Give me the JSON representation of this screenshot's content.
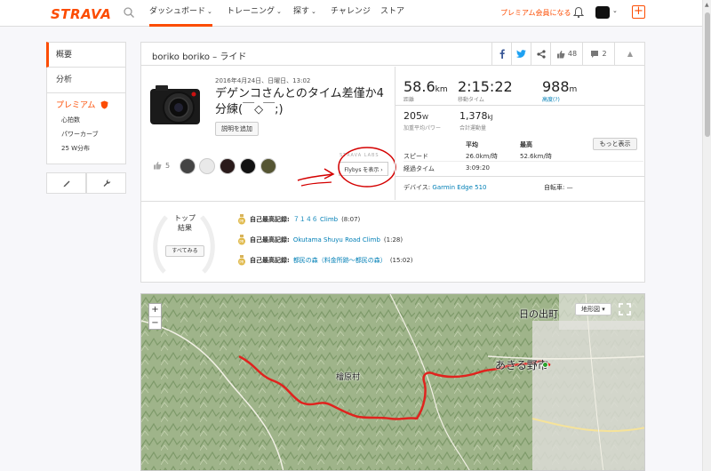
{
  "brand": "STRAVA",
  "topnav": {
    "items": [
      {
        "label": "ダッシュボード",
        "caret": "⌄"
      },
      {
        "label": "トレーニング",
        "caret": "⌄"
      },
      {
        "label": "探す",
        "caret": "⌄"
      },
      {
        "label": "チャレンジ"
      },
      {
        "label": "ストア"
      }
    ],
    "premium_link": "プレミアム会員になる",
    "plus": "+",
    "avatar_caret": "⌄"
  },
  "sidebar": {
    "items": [
      {
        "label": "概要"
      },
      {
        "label": "分析"
      }
    ],
    "premium": {
      "title": "プレミアム",
      "subs": [
        "心拍数",
        "パワーカーブ",
        "25 W分布"
      ]
    }
  },
  "activity": {
    "header_title": "boriko boriko – ライド",
    "kudos_count": "48",
    "comments_count": "2",
    "date": "2016年4月24日、日曜日、13:02",
    "title": "デゲンコさんとのタイム差僅か4分練(￣◇￣;)",
    "add_description": "説明を追加",
    "kudos_people": "5",
    "flybys_label": "STRAVA LABS",
    "flybys_button": "Flybys を表示 ›",
    "stats": {
      "distance": {
        "value": "58.6",
        "unit": "km",
        "label": "距離"
      },
      "moving_time": {
        "value": "2:15:22",
        "label": "移動タイム"
      },
      "elevation": {
        "value": "988",
        "unit": "m",
        "label": "高度(?)"
      },
      "power": {
        "value": "205",
        "unit": "W",
        "label": "加重平均パワー"
      },
      "energy": {
        "value": "1,378",
        "unit": "kJ",
        "label": "合計運動量"
      }
    },
    "table": {
      "col_avg": "平均",
      "col_max": "最高",
      "more_button": "もっと表示",
      "speed_label": "スピード",
      "speed_avg": "26.0km/時",
      "speed_max": "52.6km/時",
      "elapsed_label": "経過タイム",
      "elapsed_avg": "3:09:20"
    },
    "device_label": "デバイス:",
    "device_value": "Garmin Edge 510",
    "bike_label": "自転車: —",
    "top_results": {
      "title_line1": "トップ",
      "title_line2": "結果",
      "see_all": "すべてみる",
      "records": [
        {
          "prefix": "自己最高記録:",
          "name": "７１４６ Climb",
          "time": "(8:07)"
        },
        {
          "prefix": "自己最高記録:",
          "name": "Okutama Shuyu Road Climb",
          "time": "(1:28)"
        },
        {
          "prefix": "自己最高記録:",
          "name": "都民の森（料金所跡〜都民の森）",
          "time": "(15:02)"
        }
      ]
    }
  },
  "map": {
    "zoom_in": "+",
    "zoom_out": "−",
    "map_type": "地形図 ▾",
    "labels": {
      "hinode": "日の出町",
      "akiruno": "あきる野市",
      "hinohara": "檜原村"
    }
  },
  "colors": {
    "accent": "#fc4c02",
    "link": "#007fb6",
    "route": "#e0231e"
  }
}
